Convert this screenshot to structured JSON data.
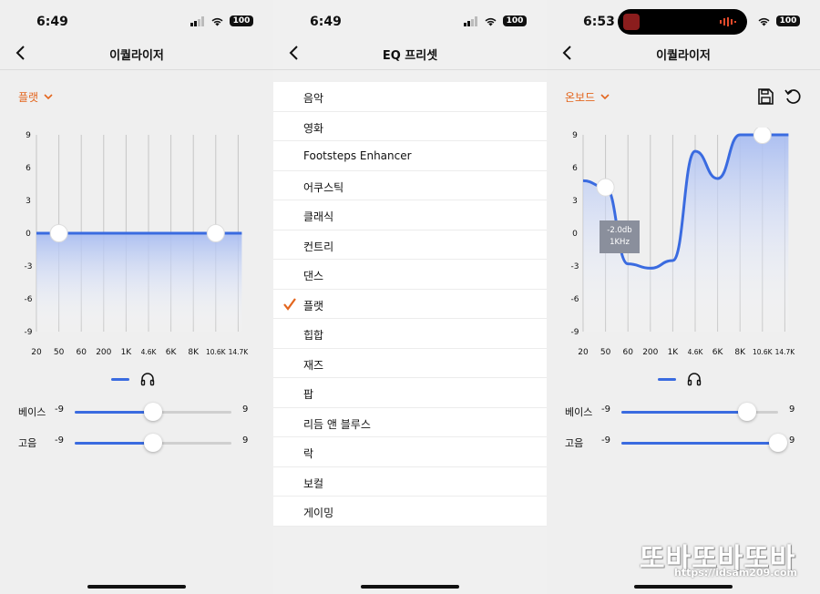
{
  "colors": {
    "accent": "#3a6be0",
    "preset": "#e3661e",
    "fill_top": "#b9c9f3"
  },
  "screen1": {
    "time": "6:49",
    "battery": "100",
    "title": "이퀄라이저",
    "preset_label": "플랫",
    "chart": {
      "y_ticks": [
        "9",
        "6",
        "3",
        "0",
        "-3",
        "-6",
        "-9"
      ],
      "x_ticks": [
        "20",
        "50",
        "60",
        "200",
        "1K",
        "4.6K",
        "6K",
        "8K",
        "10.6K",
        "14.7K"
      ],
      "values": [
        0,
        0,
        0,
        0,
        0,
        0,
        0,
        0,
        0,
        0
      ],
      "handles": [
        1,
        8
      ],
      "ylim": [
        -9,
        9
      ]
    },
    "sliders": [
      {
        "label": "베이스",
        "min": "-9",
        "max": "9",
        "value": 0
      },
      {
        "label": "고음",
        "min": "-9",
        "max": "9",
        "value": 0
      }
    ]
  },
  "screen2": {
    "time": "6:49",
    "battery": "100",
    "title": "EQ 프리셋",
    "items": [
      {
        "label": "음악"
      },
      {
        "label": "영화"
      },
      {
        "label": "Footsteps Enhancer"
      },
      {
        "label": "어쿠스틱"
      },
      {
        "label": "클래식"
      },
      {
        "label": "컨트리"
      },
      {
        "label": "댄스"
      },
      {
        "label": "플랫",
        "selected": true
      },
      {
        "label": "힙합"
      },
      {
        "label": "재즈"
      },
      {
        "label": "팝"
      },
      {
        "label": "리듬 앤 블루스"
      },
      {
        "label": "락"
      },
      {
        "label": "보컬"
      },
      {
        "label": "게이밍"
      }
    ]
  },
  "screen3": {
    "time": "6:53",
    "battery": "100",
    "title": "이퀄라이저",
    "preset_label": "온보드",
    "chart": {
      "y_ticks": [
        "9",
        "6",
        "3",
        "0",
        "-3",
        "-6",
        "-9"
      ],
      "x_ticks": [
        "20",
        "50",
        "60",
        "200",
        "1K",
        "4.6K",
        "6K",
        "8K",
        "10.6K",
        "14.7K"
      ],
      "values": [
        4.8,
        4.2,
        -2.8,
        -3.2,
        -2.5,
        7.5,
        5,
        9,
        9,
        9
      ],
      "handles": [
        1,
        8
      ],
      "ylim": [
        -9,
        9
      ]
    },
    "tooltip": {
      "line1": "-2.0db",
      "line2": "1KHz"
    },
    "sliders": [
      {
        "label": "베이스",
        "min": "-9",
        "max": "9",
        "value": 5.4
      },
      {
        "label": "고음",
        "min": "-9",
        "max": "9",
        "value": 9
      }
    ]
  },
  "watermark": {
    "brand": "또바또바또바",
    "url": "https://idsam209.com"
  }
}
